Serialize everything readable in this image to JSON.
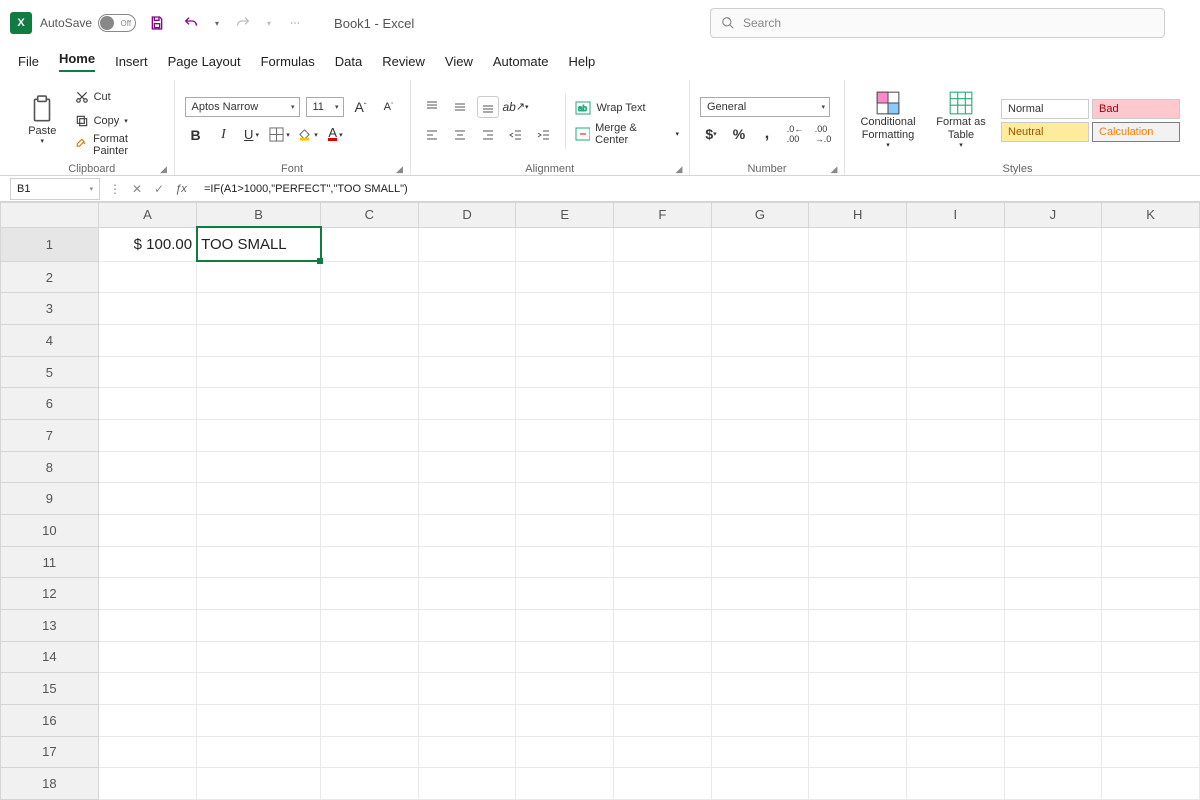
{
  "title": {
    "autosave_label": "AutoSave",
    "autosave_state": "Off",
    "document": "Book1  -  Excel",
    "search_placeholder": "Search"
  },
  "tabs": {
    "file": "File",
    "home": "Home",
    "insert": "Insert",
    "pagelayout": "Page Layout",
    "formulas": "Formulas",
    "data": "Data",
    "review": "Review",
    "view": "View",
    "automate": "Automate",
    "help": "Help"
  },
  "ribbon": {
    "clipboard": {
      "paste": "Paste",
      "cut": "Cut",
      "copy": "Copy",
      "format_painter": "Format Painter",
      "label": "Clipboard"
    },
    "font": {
      "name": "Aptos Narrow",
      "size": "11",
      "label": "Font"
    },
    "alignment": {
      "wrap": "Wrap Text",
      "merge": "Merge & Center",
      "label": "Alignment"
    },
    "number": {
      "format": "General",
      "label": "Number"
    },
    "styles": {
      "cond_fmt": "Conditional Formatting",
      "fmt_table": "Format as Table",
      "normal": "Normal",
      "bad": "Bad",
      "neutral": "Neutral",
      "calc": "Calculation",
      "label": "Styles"
    }
  },
  "formula_bar": {
    "name_box": "B1",
    "formula": "=IF(A1>1000,\"PERFECT\",\"TOO SMALL\")"
  },
  "grid": {
    "columns": [
      "A",
      "B",
      "C",
      "D",
      "E",
      "F",
      "G",
      "H",
      "I",
      "J",
      "K"
    ],
    "rows": 18,
    "cells": {
      "A1": "$ 100.00",
      "B1": "TOO SMALL"
    },
    "active": "B1"
  }
}
